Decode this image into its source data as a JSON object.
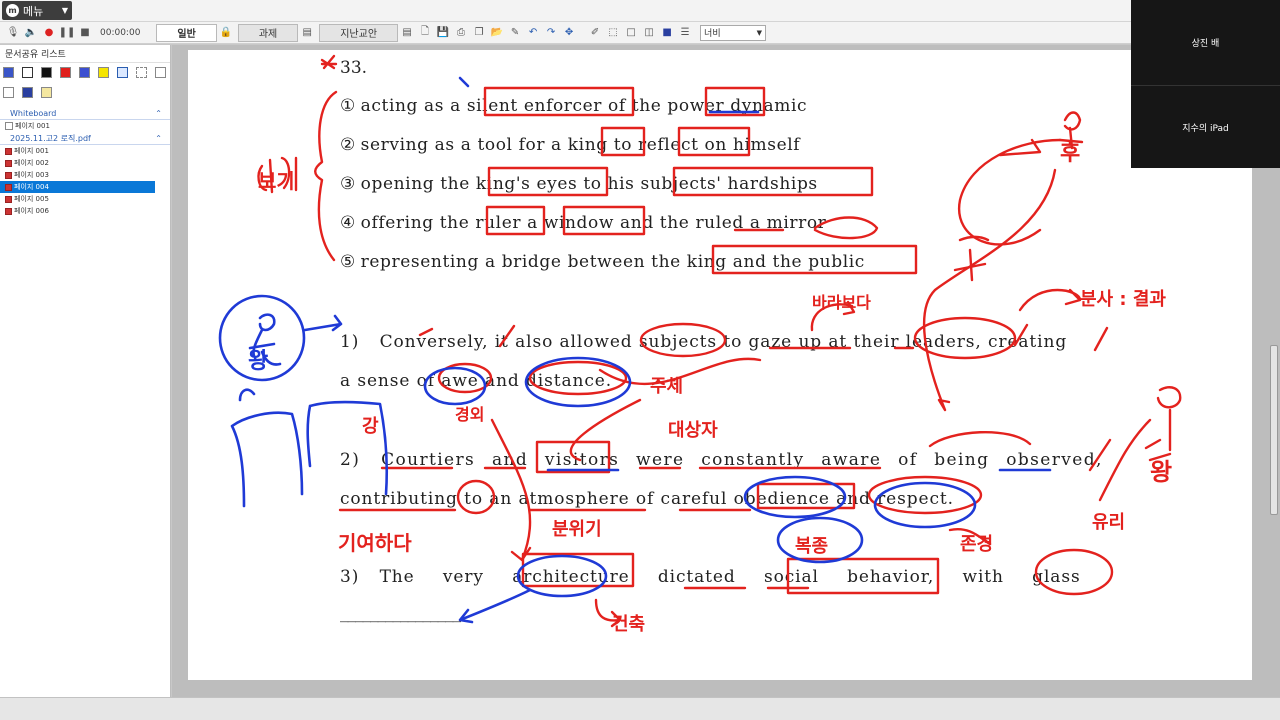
{
  "menu": {
    "label": "메뉴"
  },
  "toolbar": {
    "time": "00:00:00",
    "tabs": [
      "일반",
      "과제",
      "지난교안"
    ],
    "zoom_value": "너비"
  },
  "sidebar": {
    "title": "문서공유 리스트",
    "sections": [
      {
        "label": "Whiteboard",
        "items": [
          "페이지 001"
        ]
      },
      {
        "label": "2025.11.고2 로직.pdf",
        "items": [
          "페이지 001",
          "페이지 002",
          "페이지 003",
          "페이지 004",
          "페이지 005",
          "페이지 006"
        ]
      }
    ],
    "selected": "페이지 004"
  },
  "document": {
    "question_number": "33.",
    "options": [
      {
        "num": "①",
        "text": "acting as a silent enforcer of the power dynamic"
      },
      {
        "num": "②",
        "text": "serving as a tool for a king to reflect on himself"
      },
      {
        "num": "③",
        "text": "opening the king's eyes to his subjects' hardships"
      },
      {
        "num": "④",
        "text": "offering the ruler a window and the ruled a mirror"
      },
      {
        "num": "⑤",
        "text": "representing a bridge between the king and the public"
      }
    ],
    "passages": [
      {
        "num": "1)",
        "line1": "Conversely, it also allowed subjects to gaze up at their leaders, creating",
        "line2": "a sense of awe and distance."
      },
      {
        "num": "2)",
        "line1": "Courtiers and visitors were constantly aware of being observed,",
        "line2": "contributing to an atmosphere of careful obedience and respect."
      },
      {
        "num": "3)",
        "line1": "The very architecture dictated social behavior, with glass",
        "line2": "________________."
      }
    ]
  },
  "annotations": {
    "options_bracket": "보기",
    "top_right": "후",
    "right_note": "분사 : 결과",
    "gaze": "바라보다",
    "subject_note": "주체",
    "object_note": "대상자",
    "awe_note": "경외",
    "intensity": "강",
    "contribute": "기여하다",
    "atmosphere": "분위기",
    "obedience": "복종",
    "respect": "존경",
    "architecture": "건축",
    "left_figure": "왕",
    "right_figure": "왕",
    "glass_note": "유리"
  },
  "participants": [
    {
      "name": "상진 배"
    },
    {
      "name": "지수의 iPad"
    }
  ],
  "colors": {
    "ink_red": "#e3221e",
    "ink_blue": "#1f3ad6",
    "selection": "#0a78d7"
  }
}
